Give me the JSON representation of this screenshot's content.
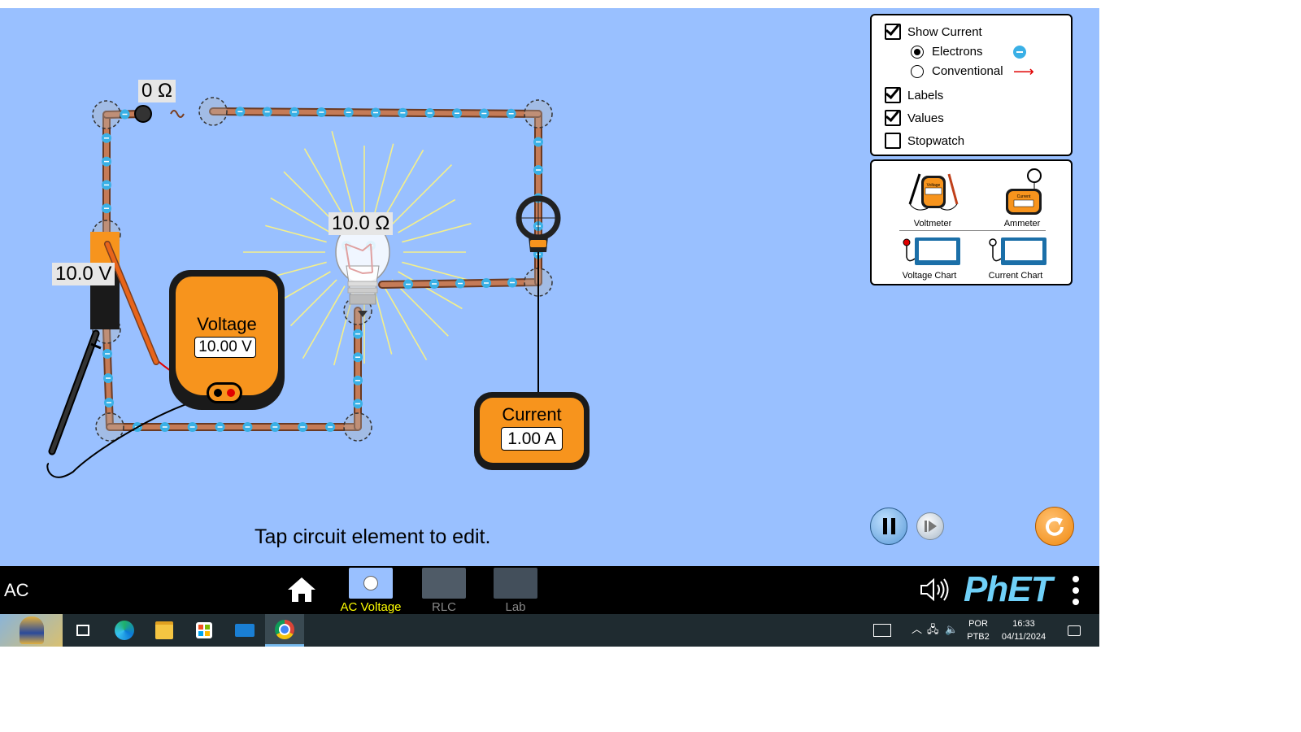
{
  "circuit": {
    "switch_resistance_label": "0 Ω",
    "bulb_resistance_label": "10.0 Ω",
    "battery_voltage_label": "10.0 V"
  },
  "voltmeter": {
    "title": "Voltage",
    "reading": "10.00 V"
  },
  "ammeter": {
    "title": "Current",
    "reading": "1.00 A"
  },
  "status_text": "Tap circuit element to edit.",
  "options_panel": {
    "show_current": {
      "label": "Show Current",
      "checked": true
    },
    "electrons": {
      "label": "Electrons",
      "selected": true
    },
    "conventional": {
      "label": "Conventional",
      "selected": false
    },
    "labels": {
      "label": "Labels",
      "checked": true
    },
    "values": {
      "label": "Values",
      "checked": true
    },
    "stopwatch": {
      "label": "Stopwatch",
      "checked": false
    }
  },
  "toolbox": {
    "voltmeter": "Voltmeter",
    "ammeter": "Ammeter",
    "voltage_chart": "Voltage Chart",
    "current_chart": "Current Chart",
    "voltmeter_icon_text": "Voltage",
    "ammeter_icon_text": "Current"
  },
  "navbar": {
    "sim_title": ": AC",
    "screens": [
      {
        "name": "AC Voltage",
        "selected": true
      },
      {
        "name": "RLC",
        "selected": false
      },
      {
        "name": "Lab",
        "selected": false
      }
    ],
    "logo": "PhET"
  },
  "taskbar": {
    "lang_top": "POR",
    "lang_bottom": "PTB2",
    "time": "16:33",
    "date": "04/11/2024"
  },
  "colors": {
    "sim_background": "#99c0ff",
    "selected_screen": "#ffff00",
    "meter_orange": "#f7941d",
    "electron_blue": "#3ab0e6",
    "wire_copper": "#c57b57"
  }
}
